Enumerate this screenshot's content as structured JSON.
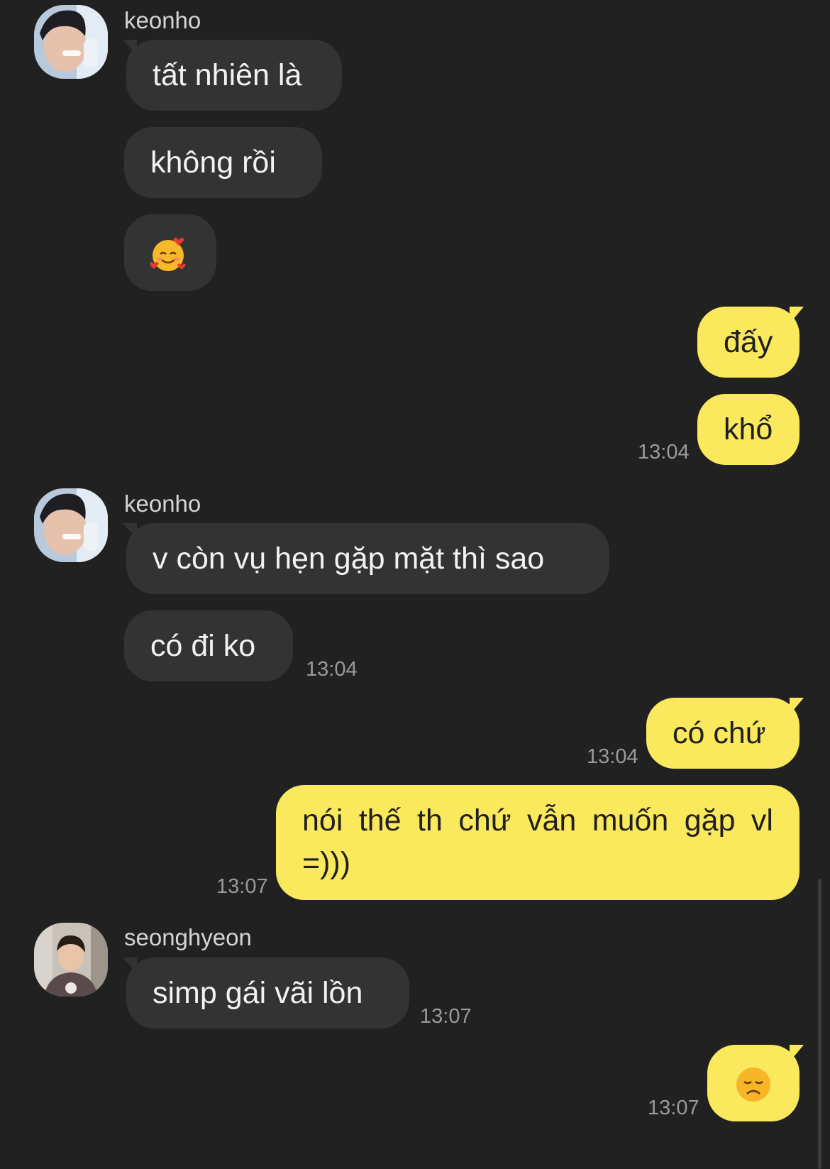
{
  "messages": [
    {
      "sender": "keonho",
      "text": "tất nhiên là"
    },
    {
      "text": "không rồi"
    },
    {
      "icon": "smiling-face-with-hearts-emoji"
    },
    {
      "text": "đấy"
    },
    {
      "text": "khổ",
      "time": "13:04"
    },
    {
      "sender": "keonho",
      "text": "v còn vụ hẹn gặp mặt thì sao"
    },
    {
      "text": "có đi ko",
      "time": "13:04"
    },
    {
      "text": "có chứ",
      "time": "13:04"
    },
    {
      "text": "nói thế th chứ vẫn muốn gặp vl =)))",
      "time": "13:07"
    },
    {
      "sender": "seonghyeon",
      "text": "simp gái vãi lồn",
      "time": "13:07"
    },
    {
      "icon": "disappointed-face-emoji",
      "time": "13:07"
    }
  ],
  "colors": {
    "background": "#212121",
    "incoming_bubble": "#333333",
    "outgoing_bubble": "#fbe95d",
    "timestamp": "#9a9a9a"
  }
}
